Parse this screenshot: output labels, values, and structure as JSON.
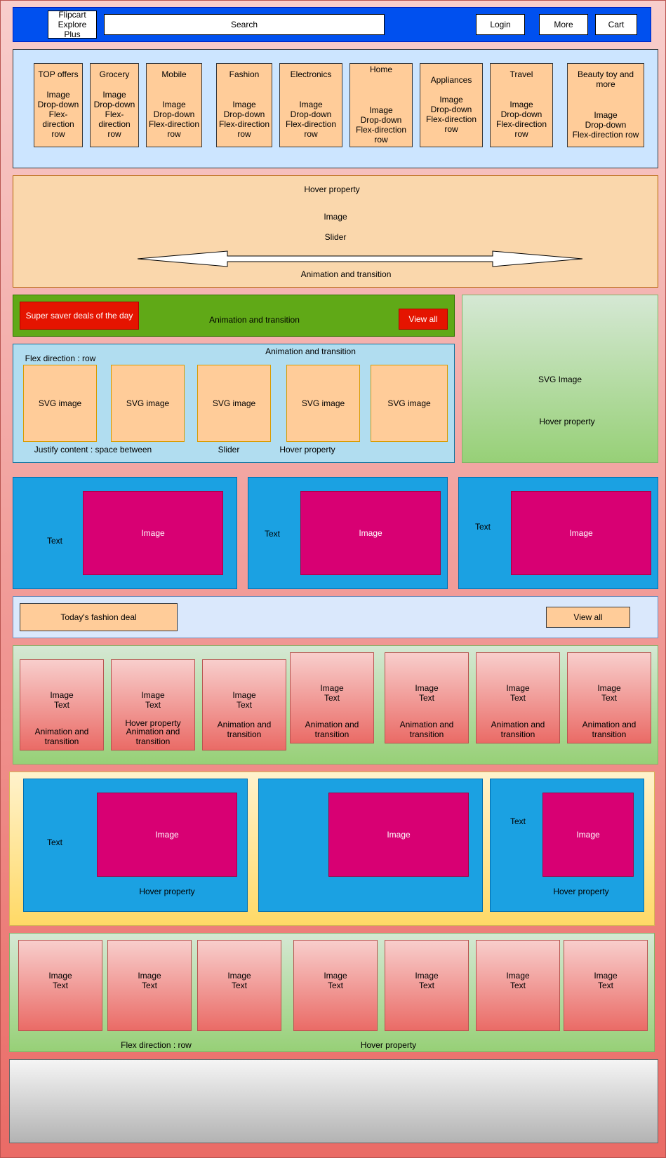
{
  "header": {
    "brand": "Flipcart\nExplore\nPlus",
    "search": "Search",
    "login": "Login",
    "more": "More",
    "cart": "Cart",
    "colors": {
      "bar": "#0050ef"
    }
  },
  "categories": [
    {
      "title": "TOP offers",
      "body": "Image\nDrop-down\nFlex-\ndirection\nrow"
    },
    {
      "title": "Grocery",
      "body": "Image\nDrop-down\nFlex-\ndirection\nrow"
    },
    {
      "title": "Mobile",
      "body": "Image\nDrop-down\nFlex-direction\nrow"
    },
    {
      "title": "Fashion",
      "body": "Image\nDrop-down\nFlex-direction\nrow"
    },
    {
      "title": "Electronics",
      "body": "Image\nDrop-down\nFlex-direction\nrow"
    },
    {
      "title": "Home",
      "body": "Image\nDrop-down\nFlex-direction\nrow"
    },
    {
      "title": "Appliances",
      "body": "Image\nDrop-down\nFlex-direction\nrow"
    },
    {
      "title": "Travel",
      "body": "Image\nDrop-down\nFlex-direction\nrow"
    },
    {
      "title": "Beauty toy and\nmore",
      "body": "Image\nDrop-down\nFlex-direction row"
    }
  ],
  "banner": {
    "hover": "Hover property",
    "image": "Image",
    "slider": "Slider",
    "animation": "Animation and transition"
  },
  "deals": {
    "title": "Super saver deals of the day",
    "animation": "Animation and transition",
    "view_all": "View all"
  },
  "svg_row": {
    "animation": "Animation and transition",
    "flex": "Flex direction : row",
    "items": [
      "SVG image",
      "SVG image",
      "SVG image",
      "SVG image",
      "SVG image"
    ],
    "justify": "Justify content : space between",
    "slider": "Slider",
    "hover": "Hover property"
  },
  "side_panel": {
    "image": "SVG Image",
    "hover": "Hover property"
  },
  "promo_row1": [
    {
      "text": "Text",
      "image": "Image"
    },
    {
      "text": "Text",
      "image": "Image"
    },
    {
      "text": "Text",
      "image": "Image"
    }
  ],
  "fashion_bar": {
    "title": "Today's fashion deal",
    "view_all": "View all"
  },
  "fashion_cards": [
    {
      "main": "Image\nText",
      "hover": "",
      "note": "Animation and\ntransition"
    },
    {
      "main": "Image\nText",
      "hover": "Hover property",
      "note": "Animation and\ntransition"
    },
    {
      "main": "Image\nText",
      "hover": "",
      "note": "Animation and\ntransition"
    },
    {
      "main": "Image\nText",
      "hover": "",
      "note": "Animation and\ntransition"
    },
    {
      "main": "Image\nText",
      "hover": "",
      "note": "Animation and\ntransition"
    },
    {
      "main": "Image\nText",
      "hover": "",
      "note": "Animation and\ntransition"
    },
    {
      "main": "Image\nText",
      "hover": "",
      "note": "Animation and\ntransition"
    }
  ],
  "promo_row2": [
    {
      "text": "Text",
      "image": "Image",
      "hover": "Hover property"
    },
    {
      "text": "",
      "image": "Image",
      "hover": ""
    },
    {
      "text": "Text",
      "image": "Image",
      "hover": "Hover property"
    }
  ],
  "bottom_cards": {
    "items": [
      "Image\nText",
      "Image\nText",
      "Image\nText",
      "Image\nText",
      "Image\nText",
      "Image\nText",
      "Image\nText"
    ],
    "flex": "Flex direction : row",
    "hover": "Hover property"
  }
}
